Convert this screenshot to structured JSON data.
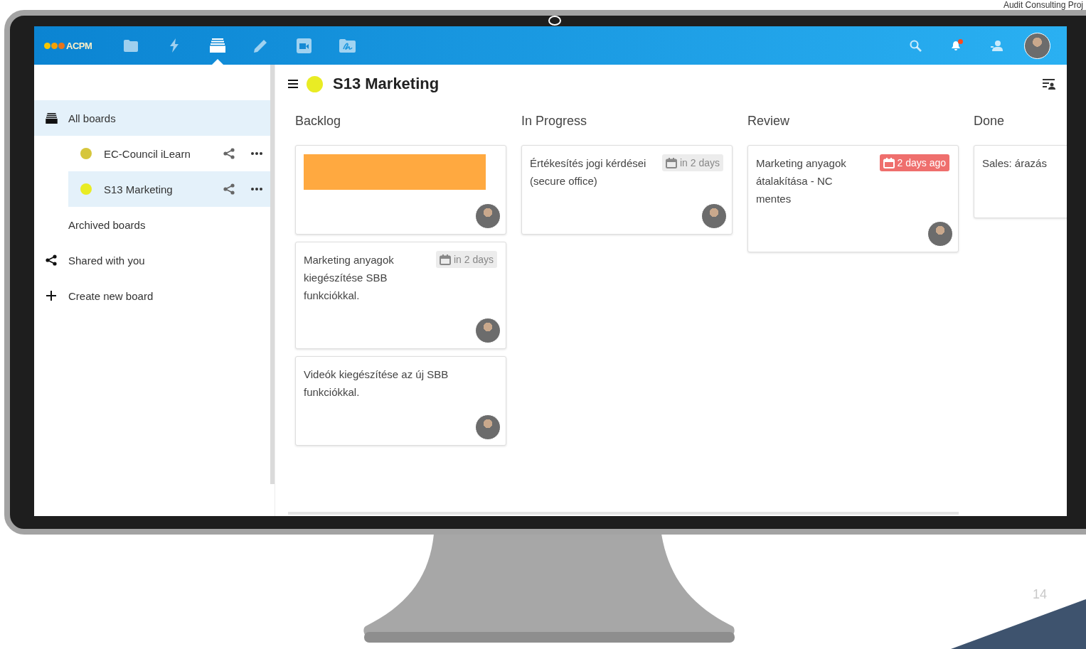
{
  "slide": {
    "title": "Audit Consulting Proj",
    "page_number": "14"
  },
  "topbar": {
    "logo": "ACPM",
    "apps": [
      {
        "kind": "folder",
        "selected": false
      },
      {
        "kind": "bolt",
        "selected": false
      },
      {
        "kind": "deck",
        "selected": true
      },
      {
        "kind": "pencil",
        "selected": false
      },
      {
        "kind": "video",
        "selected": false
      },
      {
        "kind": "signature",
        "selected": false
      }
    ],
    "actions": [
      {
        "kind": "search"
      },
      {
        "kind": "bell",
        "unread": true
      },
      {
        "kind": "contacts"
      },
      {
        "kind": "avatar"
      }
    ]
  },
  "sidebar": {
    "items": [
      {
        "kind": "boards",
        "label": "All boards",
        "selected": true,
        "children": [
          {
            "label": "EC-Council iLearn",
            "color": "#d6c63c",
            "selected": false
          },
          {
            "label": "S13 Marketing",
            "color": "#e9ec24",
            "selected": true
          }
        ]
      },
      {
        "kind": "archived",
        "label": "Archived boards",
        "selected": false
      },
      {
        "kind": "shared",
        "label": "Shared with you",
        "selected": false
      },
      {
        "kind": "create",
        "label": "Create new board",
        "selected": false
      }
    ]
  },
  "board": {
    "title": "S13 Marketing",
    "color": "#e9ec24",
    "columns": [
      {
        "title": "Backlog",
        "cards": [
          {
            "kind": "cover",
            "assigned": true
          },
          {
            "kind": "text",
            "title": "Marketing anyagok kiegészítése SBB funkciókkal.",
            "due": {
              "text": "in 2 days",
              "overdue": false
            },
            "assigned": true
          },
          {
            "kind": "text",
            "title": "Videók kiegészítése az új SBB funkciókkal.",
            "assigned": true
          }
        ]
      },
      {
        "title": "In Progress",
        "cards": [
          {
            "kind": "text",
            "title": "Értékesítés jogi kérdései (secure office)",
            "due": {
              "text": "in 2 days",
              "overdue": false
            },
            "assigned": true
          }
        ]
      },
      {
        "title": "Review",
        "cards": [
          {
            "kind": "text",
            "title": "Marketing anyagok átalakítása - NC mentes",
            "due": {
              "text": "2 days ago",
              "overdue": true
            },
            "assigned": true
          }
        ]
      },
      {
        "title": "Done",
        "cards": [
          {
            "kind": "text",
            "title": "Sales: árazás",
            "assigned": false
          }
        ]
      }
    ]
  }
}
